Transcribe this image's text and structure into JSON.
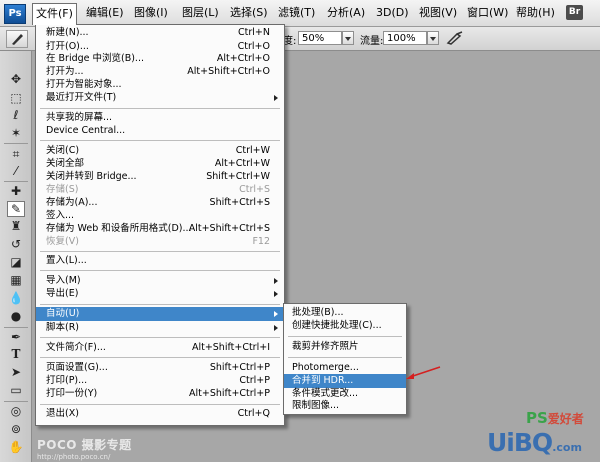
{
  "menubar": {
    "logo": "Ps",
    "items": [
      {
        "label": "文件(F)"
      },
      {
        "label": "编辑(E)"
      },
      {
        "label": "图像(I)"
      },
      {
        "label": "图层(L)"
      },
      {
        "label": "选择(S)"
      },
      {
        "label": "滤镜(T)"
      },
      {
        "label": "分析(A)"
      },
      {
        "label": "3D(D)"
      },
      {
        "label": "视图(V)"
      },
      {
        "label": "窗口(W)"
      },
      {
        "label": "帮助(H)"
      }
    ],
    "bridge_badge": "Br",
    "view_buttons": [
      "▭",
      "▤"
    ]
  },
  "options": {
    "opacity_suffix": "度:",
    "opacity_value": "50%",
    "flow_label": "流量:",
    "flow_value": "100%"
  },
  "file_menu": {
    "items": [
      {
        "label": "新建(N)...",
        "shortcut": "Ctrl+N"
      },
      {
        "label": "打开(O)...",
        "shortcut": "Ctrl+O"
      },
      {
        "label": "在 Bridge 中浏览(B)...",
        "shortcut": "Alt+Ctrl+O"
      },
      {
        "label": "打开为...",
        "shortcut": "Alt+Shift+Ctrl+O"
      },
      {
        "label": "打开为智能对象...",
        "shortcut": ""
      },
      {
        "label": "最近打开文件(T)",
        "shortcut": ""
      },
      {
        "label": "共享我的屏幕...",
        "shortcut": ""
      },
      {
        "label": "Device Central...",
        "shortcut": ""
      },
      {
        "label": "关闭(C)",
        "shortcut": "Ctrl+W"
      },
      {
        "label": "关闭全部",
        "shortcut": "Alt+Ctrl+W"
      },
      {
        "label": "关闭并转到 Bridge...",
        "shortcut": "Shift+Ctrl+W"
      },
      {
        "label": "存储(S)",
        "shortcut": "Ctrl+S"
      },
      {
        "label": "存储为(A)...",
        "shortcut": "Shift+Ctrl+S"
      },
      {
        "label": "签入...",
        "shortcut": ""
      },
      {
        "label": "存储为 Web 和设备所用格式(D)...",
        "shortcut": "Alt+Shift+Ctrl+S"
      },
      {
        "label": "恢复(V)",
        "shortcut": "F12"
      },
      {
        "label": "置入(L)...",
        "shortcut": ""
      },
      {
        "label": "导入(M)",
        "shortcut": ""
      },
      {
        "label": "导出(E)",
        "shortcut": ""
      },
      {
        "label": "自动(U)",
        "shortcut": ""
      },
      {
        "label": "脚本(R)",
        "shortcut": ""
      },
      {
        "label": "文件简介(F)...",
        "shortcut": "Alt+Shift+Ctrl+I"
      },
      {
        "label": "页面设置(G)...",
        "shortcut": "Shift+Ctrl+P"
      },
      {
        "label": "打印(P)...",
        "shortcut": "Ctrl+P"
      },
      {
        "label": "打印一份(Y)",
        "shortcut": "Alt+Shift+Ctrl+P"
      },
      {
        "label": "退出(X)",
        "shortcut": "Ctrl+Q"
      }
    ]
  },
  "automate_submenu": {
    "items": [
      {
        "label": "批处理(B)..."
      },
      {
        "label": "创建快捷批处理(C)..."
      },
      {
        "label": "裁剪并修齐照片"
      },
      {
        "label": "Photomerge..."
      },
      {
        "label": "合并到 HDR..."
      },
      {
        "label": "条件模式更改..."
      },
      {
        "label": "限制图像..."
      }
    ]
  },
  "watermarks": {
    "poco": "POCO 摄影专题",
    "poco_url": "http://photo.poco.cn/",
    "ps": "PS",
    "ps_cn": "爱好者",
    "uibq": "UiBQ",
    "uibq_com": ".com"
  },
  "colors": {
    "highlight": "#3f86c9",
    "annotation_arrow": "#d42020"
  }
}
